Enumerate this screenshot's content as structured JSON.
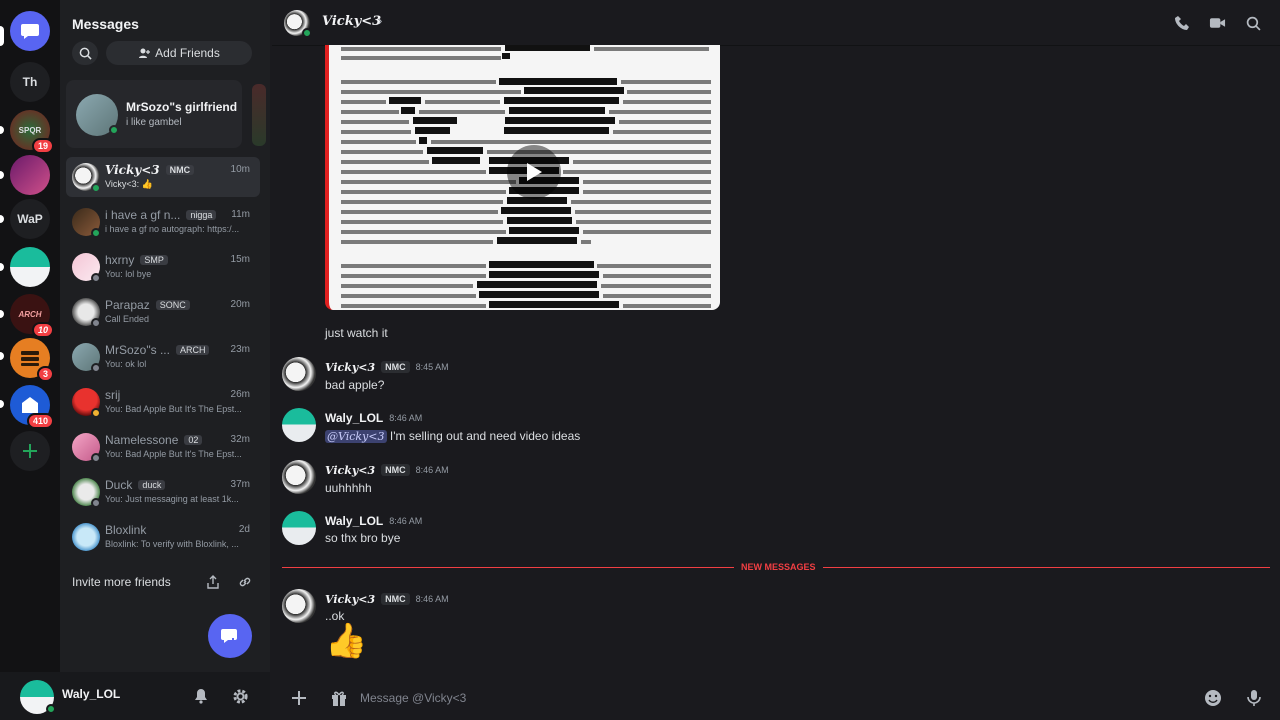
{
  "rail": {
    "servers": [
      {
        "label": "Th",
        "badge": ""
      },
      {
        "label": "SPQR",
        "badge": "19"
      },
      {
        "label": "",
        "badge": ""
      },
      {
        "label": "WaP",
        "badge": ""
      },
      {
        "label": "",
        "badge": ""
      },
      {
        "label": "ARCH",
        "badge": "10"
      },
      {
        "label": "",
        "badge": "3"
      },
      {
        "label": "",
        "badge": "410"
      }
    ]
  },
  "sidebar": {
    "title": "Messages",
    "add_friends": "Add Friends",
    "favorite": {
      "name": "MrSozo\"s girlfriend",
      "status": "i like gambel"
    },
    "dms": [
      {
        "name": "Vicky<3",
        "tag": "NMC",
        "time": "10m",
        "preview": "Vicky<3: 👍"
      },
      {
        "name": "i have a gf n...",
        "tag": "nigga",
        "time": "11m",
        "preview": "i have a gf no autograph: https:/..."
      },
      {
        "name": "hxrny",
        "tag": "SMP",
        "time": "15m",
        "preview": "You: lol bye"
      },
      {
        "name": "Parapaz",
        "tag": "SONC",
        "time": "20m",
        "preview": "Call Ended"
      },
      {
        "name": "MrSozo\"s ...",
        "tag": "ARCH",
        "time": "23m",
        "preview": "You: ok lol"
      },
      {
        "name": "srij",
        "tag": "",
        "time": "26m",
        "preview": "You: Bad Apple But It's The Epst..."
      },
      {
        "name": "Namelessone",
        "tag": "02",
        "time": "32m",
        "preview": "You: Bad Apple But It's The Epst..."
      },
      {
        "name": "Duck",
        "tag": "duck",
        "time": "37m",
        "preview": "You: Just messaging at least 1k..."
      },
      {
        "name": "Bloxlink",
        "tag": "",
        "time": "2d",
        "preview": "Bloxlink: To verify with Bloxlink, ..."
      }
    ],
    "invite_label": "Invite more friends"
  },
  "user": {
    "name": "Waly_LOL"
  },
  "chat": {
    "channel_name": "Vicky<3",
    "messages": [
      {
        "author": "",
        "role": "",
        "time": "",
        "text": "just watch it"
      },
      {
        "author": "Vicky<3",
        "role": "NMC",
        "time": "8:45 AM",
        "text": "bad apple?"
      },
      {
        "author": "Waly_LOL",
        "role": "",
        "time": "8:46 AM",
        "mention": "@Vicky<3",
        "text": " I'm selling out and need video ideas"
      },
      {
        "author": "Vicky<3",
        "role": "NMC",
        "time": "8:46 AM",
        "text": "uuhhhhh"
      },
      {
        "author": "Waly_LOL",
        "role": "",
        "time": "8:46 AM",
        "text": "so thx bro bye"
      },
      {
        "author": "Vicky<3",
        "role": "NMC",
        "time": "8:46 AM",
        "text": "..ok",
        "emoji": "👍"
      }
    ],
    "new_messages_label": "NEW MESSAGES",
    "document": {
      "lines": [
        "SHU Officer in Charge told the OIG that SHU staff ... which lists the number of",
        "inmates believed to be in the SHU at any given time.",
        "When interviewed by the OIG, the Day Watch SHU ... viewed the 4 p.m. SHU count slip from",
        "August 9, 2019, which was signed by the Evening ... Based on his",
        "review, the Day Watch Officer in Charge told ... Officer in Charge and",
        "Noel probably did ... the inmates in the SHU ... the numbers they",
        "thought should have ... entered for the count ... included an inmate",
        "Inmate 4) among the ... inmates ... transferred to another",
        "housing unit. According ... August 9, earlier that afternoon",
        "the Day Watch SHU Officer ... gave an unknown item from his",
        "visitor in the MCC New York ... room ... from August 9, 2019, reflected that",
        "following this incident, Inmate 4 was removed ... p.m. and transferred to the Receiving",
        "and Discharge dry cell, which is a secure location ... taken for observation when they are",
        "believed to have ingested or secreted contraband ... According to the Day Watch SHU Officer",
        "in Charge, the inaccurate 4 p.m. count slip told ... was not done and they just assumed and",
        "went by the cheat sheet because the body was ... returning to Inmate 4, who was transferred",
        "from the SHU to Receiving and Discharge. The ... Officer in Charge told the OIG that if the",
        "4 p.m. SHU count had been accurately conducted ... Watch SHU Officer in Charge and the",
        "SHU staff should have realized that Inmate 4 was ... U.",
        "In his interview with the OIG, the Evening Watch ... acknowledged that neither he nor",
        "any other SHU staff member conducted the 4 p.m. ... The Evening Watch SHU Officer",
        "in Charge verified that it was his handwriting ... count slip and said he had",
        "prepared the count slip ahead of time because ... in the SHU that day. The",
        "Evening Watch SHU Officer in Charge confirmed ... also appeared on the 4 p.m."
      ]
    }
  },
  "composer": {
    "placeholder": "Message @Vicky<3"
  },
  "colors": {
    "accent": "#5865f2",
    "danger": "#f23f43",
    "online": "#23a55a",
    "idle": "#f0b232"
  },
  "icons": {
    "search": "search-icon",
    "add_friend": "add-friend-icon",
    "phone": "phone-icon",
    "video": "video-icon",
    "inbox": "inbox-icon",
    "bell": "bell-icon",
    "gear": "gear-icon",
    "gift": "gift-icon",
    "emoji": "emoji-icon",
    "mic": "mic-icon"
  }
}
